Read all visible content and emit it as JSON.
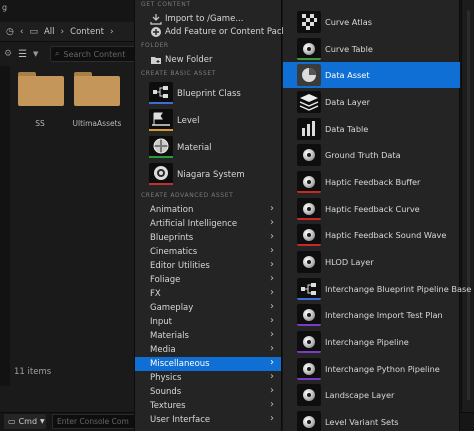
{
  "window": {
    "title_fragment": "g"
  },
  "content_browser": {
    "breadcrumb": [
      "All",
      "Content"
    ],
    "search_placeholder": "Search Content",
    "folders": [
      {
        "label": "SS"
      },
      {
        "label": "UltimaAssets"
      }
    ],
    "status": "11 items",
    "cmd_label": "Cmd",
    "console_placeholder": "Enter Console Com"
  },
  "menu": {
    "sections": {
      "get_content": "GET CONTENT",
      "folder": "FOLDER",
      "basic": "CREATE BASIC ASSET",
      "advanced": "CREATE ADVANCED ASSET"
    },
    "get_content_items": [
      {
        "label": "Import to /Game...",
        "icon": "import-icon"
      },
      {
        "label": "Add Feature or Content Pack...",
        "icon": "add-pack-icon"
      }
    ],
    "folder_items": [
      {
        "label": "New Folder",
        "icon": "folder-icon"
      }
    ],
    "basic_items": [
      {
        "label": "Blueprint Class",
        "icon": "blueprint-icon",
        "accent": "#3c6fd1"
      },
      {
        "label": "Level",
        "icon": "level-icon",
        "accent": "#d49a2b"
      },
      {
        "label": "Material",
        "icon": "material-icon",
        "accent": "#2b9a3a"
      },
      {
        "label": "Niagara System",
        "icon": "niagara-icon",
        "accent": "#c13030"
      }
    ],
    "advanced_items": [
      {
        "label": "Animation"
      },
      {
        "label": "Artificial Intelligence"
      },
      {
        "label": "Blueprints"
      },
      {
        "label": "Cinematics"
      },
      {
        "label": "Editor Utilities"
      },
      {
        "label": "Foliage"
      },
      {
        "label": "FX"
      },
      {
        "label": "Gameplay"
      },
      {
        "label": "Input"
      },
      {
        "label": "Materials"
      },
      {
        "label": "Media"
      },
      {
        "label": "Miscellaneous",
        "selected": true
      },
      {
        "label": "Physics"
      },
      {
        "label": "Sounds"
      },
      {
        "label": "Textures"
      },
      {
        "label": "User Interface"
      }
    ]
  },
  "submenu": {
    "items": [
      {
        "label": "Curve Atlas",
        "icon": "curve-atlas-icon",
        "accent": "#8a8a8a"
      },
      {
        "label": "Curve Table",
        "icon": "curve-table-icon",
        "accent": "#3d9a3d"
      },
      {
        "label": "Data Asset",
        "icon": "data-asset-icon",
        "accent": "#555555",
        "selected": true
      },
      {
        "label": "Data Layer",
        "icon": "data-layer-icon",
        "accent": "#555555"
      },
      {
        "label": "Data Table",
        "icon": "data-table-icon",
        "accent": "#555555"
      },
      {
        "label": "Ground Truth Data",
        "icon": "ground-truth-icon",
        "accent": "#555555"
      },
      {
        "label": "Haptic Feedback Buffer",
        "icon": "haptic-buffer-icon",
        "accent": "#c42a2a"
      },
      {
        "label": "Haptic Feedback Curve",
        "icon": "haptic-curve-icon",
        "accent": "#c42a2a"
      },
      {
        "label": "Haptic Feedback Sound Wave",
        "icon": "haptic-sound-icon",
        "accent": "#c42a2a"
      },
      {
        "label": "HLOD Layer",
        "icon": "hlod-icon",
        "accent": "#555555"
      },
      {
        "label": "Interchange Blueprint Pipeline Base",
        "icon": "interchange-bp-icon",
        "accent": "#3c6fd1"
      },
      {
        "label": "Interchange Import Test Plan",
        "icon": "interchange-test-icon",
        "accent": "#7b3cc4"
      },
      {
        "label": "Interchange Pipeline",
        "icon": "interchange-pipeline-icon",
        "accent": "#7b3cc4"
      },
      {
        "label": "Interchange Python Pipeline",
        "icon": "interchange-python-icon",
        "accent": "#7b3cc4"
      },
      {
        "label": "Landscape Layer",
        "icon": "landscape-layer-icon",
        "accent": "#555555"
      },
      {
        "label": "Level Variant Sets",
        "icon": "level-variant-icon",
        "accent": "#555555"
      }
    ]
  }
}
